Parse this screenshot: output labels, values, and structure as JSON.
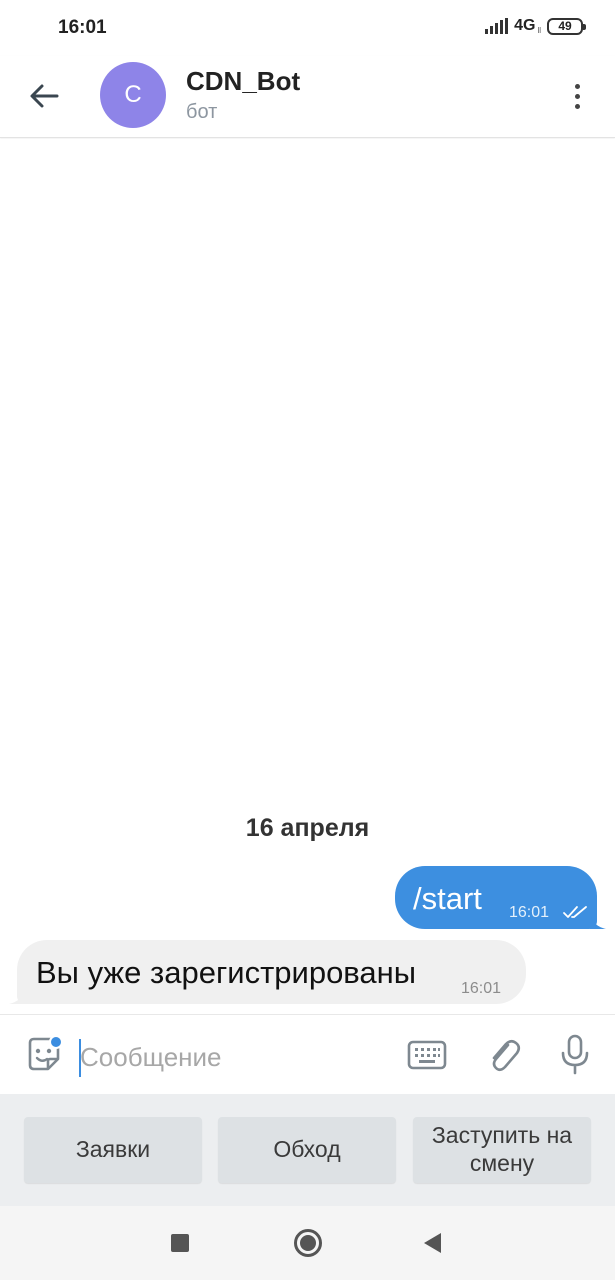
{
  "status_bar": {
    "time": "16:01",
    "network": "4G",
    "network_sub": "ll",
    "battery": "49"
  },
  "header": {
    "back_icon": "arrow-left-icon",
    "avatar_letter": "C",
    "title": "CDN_Bot",
    "subtitle": "бот",
    "menu_icon": "more-vert-icon"
  },
  "chat": {
    "date_separator": "16 апреля",
    "messages": [
      {
        "direction": "outgoing",
        "text": "/start",
        "time": "16:01",
        "status": "read"
      },
      {
        "direction": "incoming",
        "text": "Вы уже зарегистрированы",
        "time": "16:01"
      }
    ]
  },
  "input": {
    "placeholder": "Сообщение",
    "value": ""
  },
  "bot_keyboard": {
    "buttons": [
      "Заявки",
      "Обход",
      "Заступить на смену"
    ]
  },
  "colors": {
    "accent": "#3b8de0",
    "avatar": "#8e84e8",
    "outgoing_bubble": "#3d8fe0",
    "incoming_bubble": "#f0f0f0"
  }
}
